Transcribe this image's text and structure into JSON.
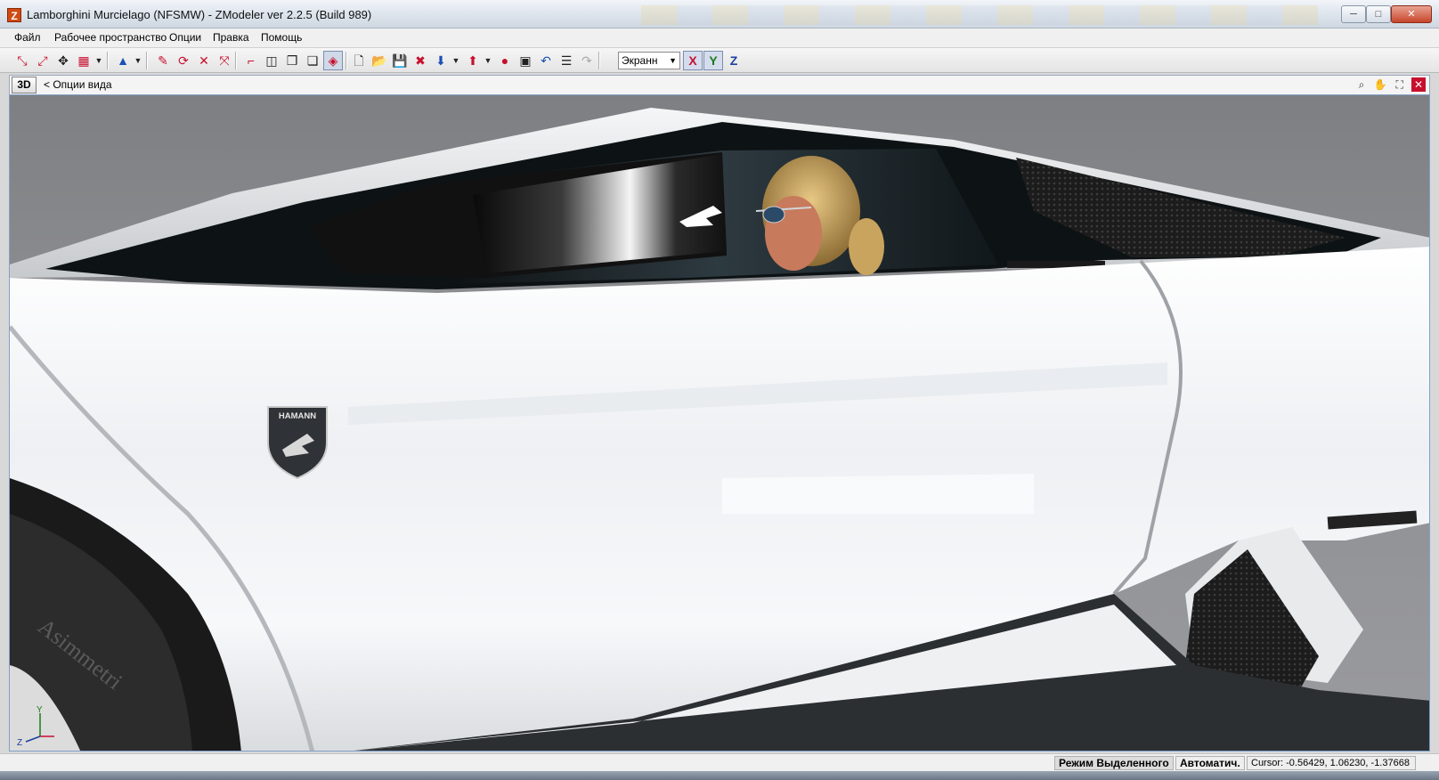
{
  "window": {
    "title": "Lamborghini Murcielago  (NFSMW) - ZModeler ver 2.2.5 (Build 989)",
    "app_icon": "Z",
    "controls": {
      "minimize": "─",
      "maximize": "□",
      "close": "✕"
    }
  },
  "menu": {
    "items": [
      "Файл",
      "Рабочее пространство",
      "Опции",
      "Правка",
      "Помощь"
    ]
  },
  "toolbar": {
    "view_select": "Экранн",
    "axis_x": "X",
    "axis_y": "Y",
    "axis_z": "Z"
  },
  "viewport": {
    "mode_button": "3D",
    "options_label": "<  Опции вида",
    "badge_text": "HAMANN",
    "axis_gizmo": {
      "y": "Y",
      "z": "Z"
    },
    "colors": {
      "background": "#8b8c8f",
      "body": "#f4f5f7",
      "glass": "#1d2428",
      "tire": "#1a1a1a"
    }
  },
  "statusbar": {
    "mode": "Режим Выделенного",
    "auto": "Автоматич.",
    "cursor": "Cursor: -0.56429, 1.06230, -1.37668"
  },
  "icons": [
    "zmodeler-app-icon",
    "select-icon",
    "move-icon",
    "rotate-icon",
    "scale-icon",
    "pyramid-icon",
    "new-file-icon",
    "open-folder-icon",
    "save-icon",
    "delete-icon",
    "undo-icon",
    "redo-icon",
    "zoom-icon",
    "pan-icon",
    "maximize-view-icon",
    "close-view-icon"
  ]
}
